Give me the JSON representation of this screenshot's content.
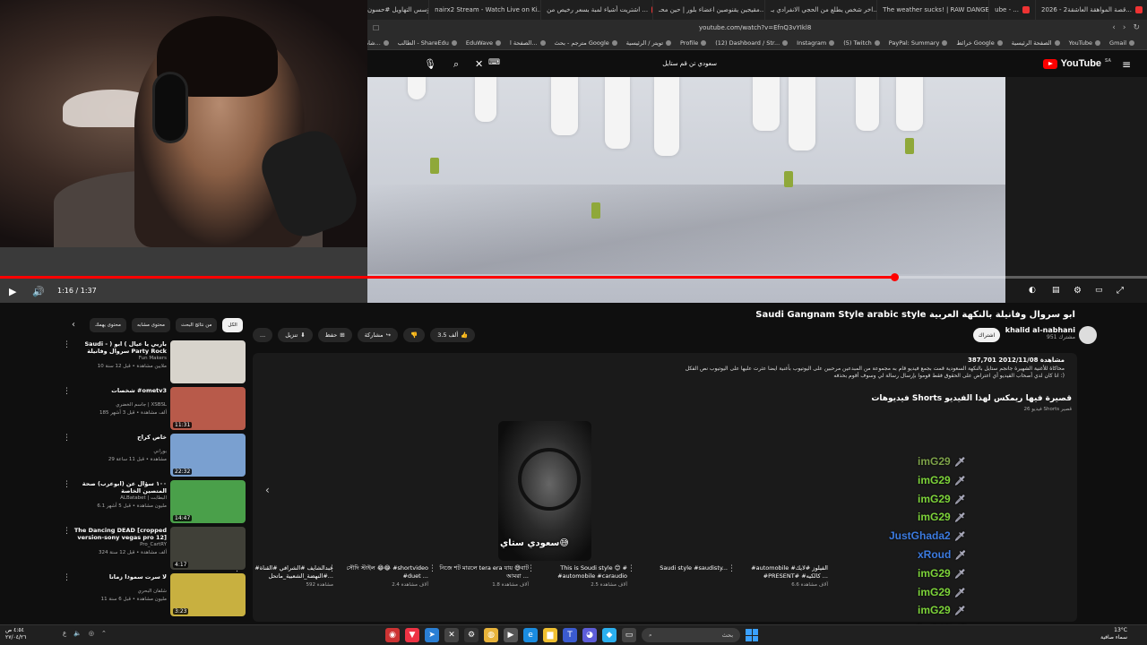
{
  "browser": {
    "tabs": [
      {
        "label": "2026 - قصة المواهقة العاشقة2...",
        "color": "#e33"
      },
      {
        "label": "ube - ...",
        "color": "#e33"
      },
      {
        "label": "The weather sucks! | RAW DANGER ...",
        "color": "#e33"
      },
      {
        "label": "اخر شخص يطلع من الحجي الانفرادي يـ...",
        "color": "#e33"
      },
      {
        "label": "مقيجين يقنوصين اعضاء بلور | حين محـ...",
        "color": "#e33"
      },
      {
        "label": "اشتريت أشياء لمبة بسعر رخيص من ...",
        "color": "#e33"
      },
      {
        "label": "nairx2 Stream - Watch Live on Ki...",
        "color": "#53fc18"
      },
      {
        "label": "مؤسس التهاويل #حسون #حسون البارات...",
        "color": "#444"
      }
    ],
    "url": "youtube.com/watch?v=EfnQ3vYIkl8",
    "bookmarks": [
      "Gmail",
      "YouTube",
      "الصفحة الرئيسية",
      "خرائط Google",
      "PayPal: Summary",
      "(5) Twitch",
      "Instagram",
      "(12) Dashboard / Str...",
      "Profile",
      "تويتر / الرئيسية",
      "مترجم - بحث Google",
      "الصفحة ا...",
      "EduWave",
      "الطالب - ShareEdu",
      "شاهد فيديوهات مت...",
      "تحميل فيد..."
    ]
  },
  "youtube": {
    "logo_text": "YouTube",
    "logo_region": "SA",
    "search_value": "سعودي تن قم ستايل"
  },
  "player": {
    "timecode": "1:16 / 1:37",
    "progress_fraction": 0.78
  },
  "video": {
    "title": "Saudi Gangnam Style arabic style ابو سروال وفانيلة بالنكهة العربية",
    "channel_name": "khalid al-nabhani",
    "channel_subs": "951 مشترك",
    "subscribe_label": "اشتراك",
    "like_count": "3.5 ألف",
    "share_label": "مشاركة",
    "save_label": "حفظ",
    "download_label": "تنزيل",
    "more_label": "..."
  },
  "description": {
    "meta": "387,701 مشاهدة  2012/11/08",
    "line1": "محاكاة للأغنية الشهيرة جانجم ستايل بالنكهة السعودية قمت بجمع فيديو قام به مجموعة من المبدعين مرحبين على اليوتيوب بأغنية ايضا عثرت عليها على اليوتيوب نص الفكل",
    "line2": "انا كان لدي أصحاب الفيديو أي اعتراض على الحقوق فقط قوموا بإرسال رسالة لي وسوف أقوم بحذفه :)"
  },
  "shorts": {
    "heading": "فيديوهات Shorts قصيرة فيها ريمكس لهذا الفيديو",
    "sub": "26 فيديو Shorts قصير",
    "thumb_caption": "سعودي ستاي😅",
    "items": [
      {
        "title": "#automobile #الفيلوز #لايك #PRESENT# #كالكيه ...",
        "views": "6.6 آلاف مشاهدة"
      },
      {
        "title": "Saudi style #saudisty...",
        "views": ""
      },
      {
        "title": "This is Soudi style 😊 # #automobile #caraudio",
        "views": "2.5 آلاف مشاهدة"
      },
      {
        "title": "নিজে শট মারলে tera era যায় 😅বাট আমরা ...",
        "views": "1.8 آلاف مشاهدة"
      },
      {
        "title": "সৌদি স্টাইল 😂😂 #shortvideo #duet ...",
        "views": "2.4 آلاف مشاهدة"
      },
      {
        "title": "#عبدالشايف #الشرافي #القناة #النهضة_الشعبية_ماتحل...",
        "views": "592 مشاهدة"
      }
    ]
  },
  "chat": [
    {
      "user": "imG29",
      "color": "#7ea24a"
    },
    {
      "user": "imG29",
      "color": "#7dd33a"
    },
    {
      "user": "imG29",
      "color": "#7dd33a"
    },
    {
      "user": "imG29",
      "color": "#7dd33a"
    },
    {
      "user": "JustGhada2",
      "color": "#3c7be0"
    },
    {
      "user": "xRoud",
      "color": "#3c7be0"
    },
    {
      "user": "imG29",
      "color": "#7dd33a"
    },
    {
      "user": "imG29",
      "color": "#7dd33a"
    },
    {
      "user": "imG29",
      "color": "#7dd33a"
    },
    {
      "user": "imG29",
      "color": "#7dd33a"
    }
  ],
  "chips": [
    "الكل",
    "من نتائج البحث",
    "محتوى مشابه",
    "محتوى يهمك"
  ],
  "recommendations": [
    {
      "title": "Saudi - ) باريي يا عيال ) ابو سروال وفانيلة Party Rock",
      "channel": "Fun Makers",
      "views": "10 ملايين مشاهدة • قبل 12 سنة",
      "duration": "",
      "thumb": "#d8d4cc"
    },
    {
      "title": "شخصات #ometv3",
      "channel": "جاسم الخضري | XSBSL",
      "views": "185 ألف مشاهدة • قبل 3 أشهر",
      "duration": "11:31",
      "thumb": "#b85a4a"
    },
    {
      "title": "خاص كراج",
      "channel": "بوراني",
      "views": "29 مشاهدة • قبل 11 ساعة",
      "duration": "22:32",
      "thumb": "#7aa0d0"
    },
    {
      "title": "١٠٠ سؤال عن (ابوعرب) صحة المتصين الخاصة",
      "channel": "ALBatabet | البطابت",
      "views": "6.1 مليون مشاهدة • قبل 5 أشهر",
      "duration": "14:47",
      "thumb": "#4aa04a"
    },
    {
      "title": "The Dancing DEAD [cropped version-sony vegas pro 12]",
      "channel": "Pro_CartRY",
      "views": "324 ألف مشاهدة • قبل 12 سنة",
      "duration": "4:17",
      "thumb": "#404038"
    },
    {
      "title": "لا سرت سموذا زمانا",
      "channel": "شلفان البحري",
      "views": "11 مليون مشاهدة • قبل 6 سنة",
      "duration": "3:23",
      "thumb": "#c8b040"
    }
  ],
  "taskbar": {
    "search_placeholder": "بحث",
    "clock_time": "٤:٥٤ ص",
    "clock_date": "٢٧/٠٤/٢٦",
    "weather_temp": "13°C",
    "weather_desc": "سماء صافية"
  },
  "colors": {
    "accent_red": "#ff0000",
    "bg": "#0f0f0f"
  }
}
